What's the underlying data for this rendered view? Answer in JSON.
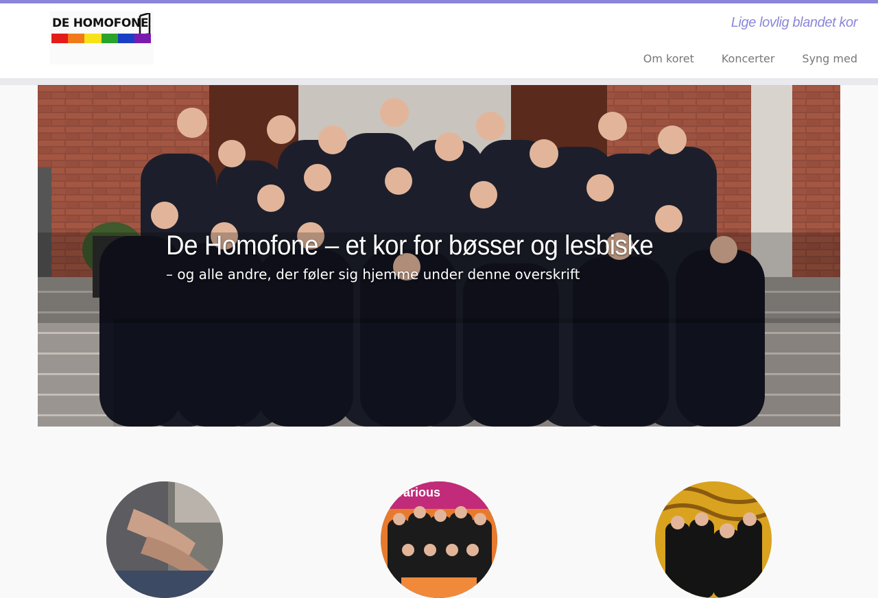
{
  "site": {
    "logo_text": "De Homofone",
    "tagline": "Lige lovlig blandet kor",
    "brand_color": "#8b86d9",
    "rainbow_colors": [
      "#e31b1b",
      "#f07a1a",
      "#f7e21a",
      "#2aa32a",
      "#1b3fc4",
      "#7a1bb0"
    ]
  },
  "nav": {
    "items": [
      {
        "label": "Om koret"
      },
      {
        "label": "Koncerter"
      },
      {
        "label": "Syng med"
      }
    ]
  },
  "hero": {
    "title": "De Homofone – et kor for bøsser og lesbiske",
    "subtitle": "– og alle andre, der føler sig hjemme under denne overskrift"
  },
  "features": {
    "items": [
      {
        "image": "choir-hands-photo"
      },
      {
        "image": "choir-group-photo"
      },
      {
        "image": "choir-concert-photo"
      }
    ]
  }
}
